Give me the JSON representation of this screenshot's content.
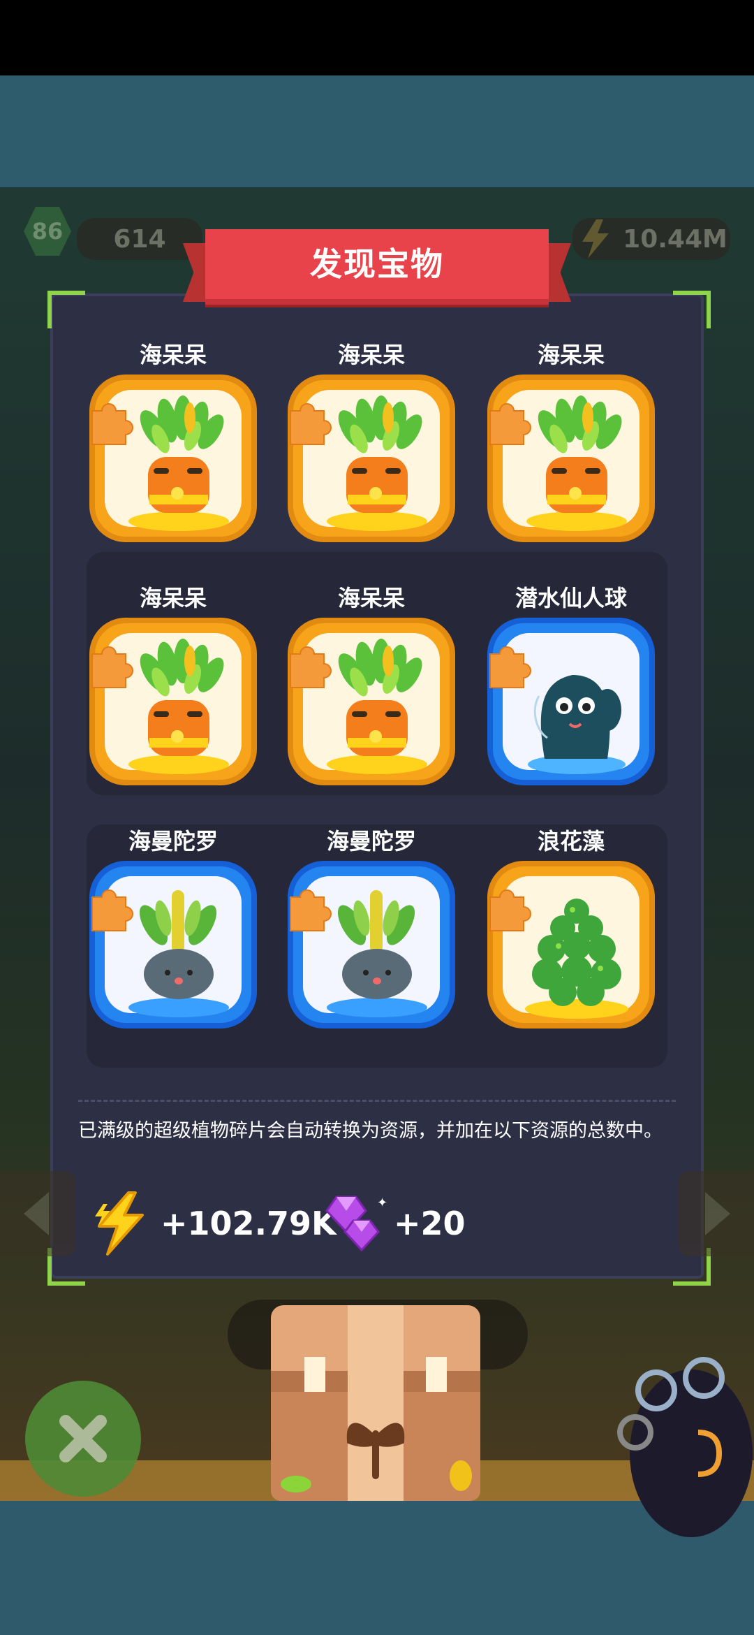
{
  "hud": {
    "level": "86",
    "stat_1": "614",
    "stat_2": "...",
    "stat_3": "...",
    "energy": "10.44M"
  },
  "dialog": {
    "title": "发现宝物",
    "items": [
      {
        "name": "海呆呆",
        "rarity": "gold",
        "plant": "carrot-plant"
      },
      {
        "name": "海呆呆",
        "rarity": "gold",
        "plant": "carrot-plant"
      },
      {
        "name": "海呆呆",
        "rarity": "gold",
        "plant": "carrot-plant"
      },
      {
        "name": "海呆呆",
        "rarity": "gold",
        "plant": "carrot-plant"
      },
      {
        "name": "海呆呆",
        "rarity": "gold",
        "plant": "carrot-plant"
      },
      {
        "name": "潜水仙人球",
        "rarity": "blue",
        "plant": "cactus-plant"
      },
      {
        "name": "海曼陀罗",
        "rarity": "blue",
        "plant": "radish-plant"
      },
      {
        "name": "海曼陀罗",
        "rarity": "blue",
        "plant": "radish-plant"
      },
      {
        "name": "浪花藻",
        "rarity": "gold",
        "plant": "seaweed-plant"
      }
    ],
    "info_text": "已满级的超级植物碎片会自动转换为资源，并加在以下资源的总数中。",
    "rewards": {
      "energy_amount": "+102.79K",
      "gem_amount": "+20"
    }
  },
  "colors": {
    "gold_card": "#f7a41a",
    "blue_card": "#2585f0",
    "title_ribbon": "#e8434a",
    "panel": "#2d2f45",
    "corner_accent": "#8fd44a"
  }
}
